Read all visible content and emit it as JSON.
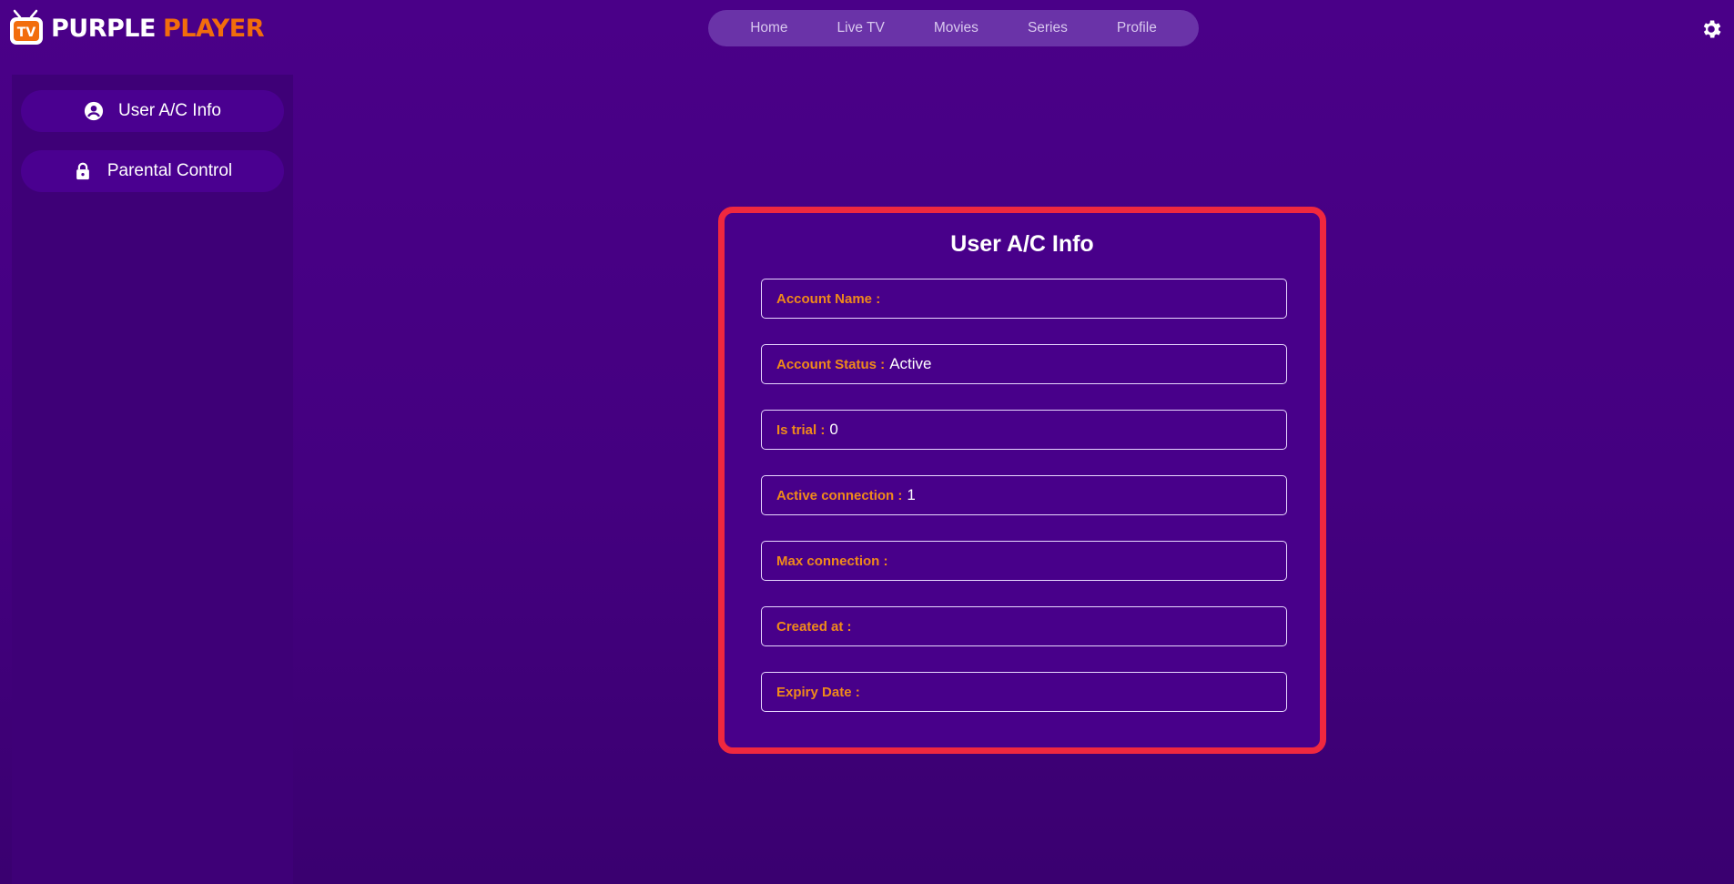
{
  "brand": {
    "word1": "PURPLE",
    "word2": "PLAYER",
    "badge": "TV",
    "accent": "#f26d0c"
  },
  "topnav": {
    "items": [
      "Home",
      "Live TV",
      "Movies",
      "Series",
      "Profile"
    ]
  },
  "header": {
    "settings_icon": "gear-icon"
  },
  "sidebar": {
    "items": [
      {
        "label": "User A/C Info",
        "icon": "user-circle-icon"
      },
      {
        "label": "Parental Control",
        "icon": "lock-icon"
      }
    ]
  },
  "card": {
    "title": "User A/C Info",
    "fields": [
      {
        "label": "Account Name :",
        "value": ""
      },
      {
        "label": "Account Status :",
        "value": "Active"
      },
      {
        "label": "Is trial :",
        "value": "0"
      },
      {
        "label": "Active connection :",
        "value": "1"
      },
      {
        "label": "Max connection :",
        "value": ""
      },
      {
        "label": "Created at :",
        "value": ""
      },
      {
        "label": "Expiry Date :",
        "value": ""
      }
    ],
    "border_color": "#f0283f"
  }
}
